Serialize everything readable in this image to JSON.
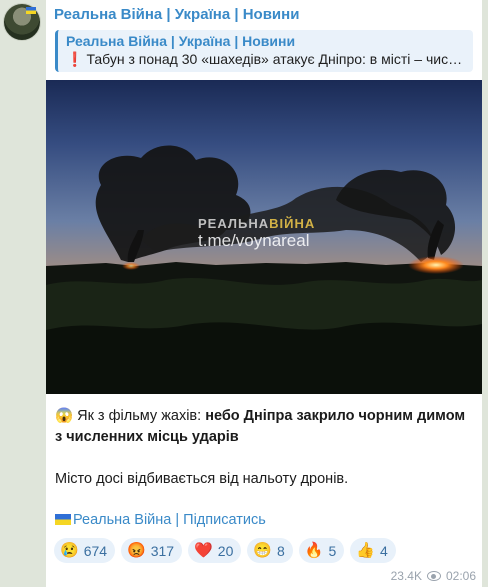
{
  "post": {
    "channel": "Реальна Війна | Україна | Новини",
    "reply": {
      "title": "Реальна Війна | Україна | Новини",
      "excl_icon": "❗",
      "text": "Табун з понад 30 «шахедів» атакує Дніпро: в місті – числ..."
    },
    "media": {
      "watermark_line1_a": "РЕАЛЬНА",
      "watermark_line1_b": "ВІЙНА",
      "watermark_line2": "t.me/voynareal"
    },
    "message": {
      "emoji": "😱",
      "plain": " Як з фільму жахів: ",
      "bold": "небо Дніпра закрило чорним димом з численних місць ударів",
      "line2": "Місто досі відбивається від нальоту дронів.",
      "subscribe": "Реальна Війна | Підписатись"
    },
    "reactions": [
      {
        "emoji": "😢",
        "count": "674"
      },
      {
        "emoji": "😡",
        "count": "317"
      },
      {
        "emoji": "❤️",
        "count": "20"
      },
      {
        "emoji": "😁",
        "count": "8"
      },
      {
        "emoji": "🔥",
        "count": "5"
      },
      {
        "emoji": "👍",
        "count": "4"
      }
    ],
    "views": "23.4K",
    "time": "02:06"
  },
  "colors": {
    "accent": "#3a8ac8",
    "background": "#dfe5da",
    "bubble": "#ffffff"
  }
}
